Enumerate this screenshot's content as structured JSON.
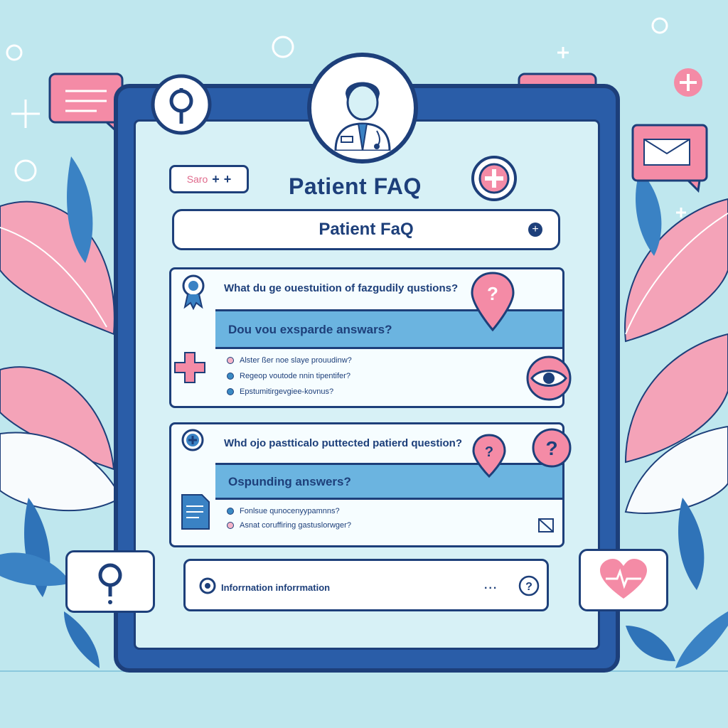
{
  "search": {
    "label": "Saro",
    "plus1": "+",
    "plus2": "+"
  },
  "header": {
    "title": "Patient FAQ"
  },
  "titlebar": {
    "label": "Patient FaQ"
  },
  "faq": [
    {
      "question": "What du ge ouestuition of fazgudily qustions?",
      "answer_heading": "Dou vou exsparde answars?",
      "bullets": [
        {
          "text": "Alster ßer noe slaye prouudinw?",
          "color": "pink"
        },
        {
          "text": "Regeop voutode nnin tipentifer?",
          "color": "blue"
        },
        {
          "text": "Epstumitirgevgiee-kovnus?",
          "color": "blue"
        }
      ]
    },
    {
      "question": "Whd ojo pastticalo puttected patierd question?",
      "answer_heading": "Ospunding answers?",
      "bullets": [
        {
          "text": "Fonlsue qunocenyypamnns?",
          "color": "blue"
        },
        {
          "text": "Asnat coruffiring gastuslorwger?",
          "color": "pink"
        }
      ]
    }
  ],
  "info_bar": {
    "text": "Inforrnation inforrmation",
    "dots": "..."
  },
  "colors": {
    "navy": "#1d3f7a",
    "pink": "#f48ba6",
    "sky": "#bfe7ee",
    "accent_blue": "#6bb4e0"
  },
  "icons": [
    "search-icon",
    "doctor-avatar-icon",
    "medical-cross-icon",
    "chat-bubble-icon",
    "mail-icon",
    "question-pin-icon",
    "eye-icon",
    "document-icon",
    "heart-pulse-icon",
    "award-badge-icon",
    "leaf-decoration-icon"
  ]
}
